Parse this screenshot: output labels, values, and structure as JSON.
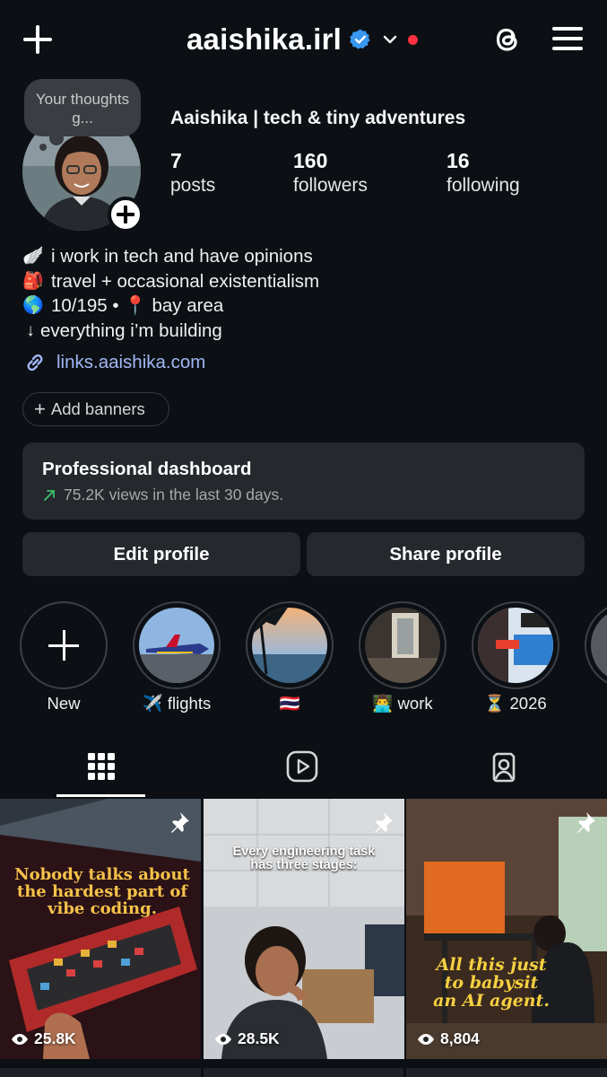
{
  "header": {
    "username": "aaishika.irl",
    "icons": {
      "new_post": "plus-icon",
      "verified": "verified-badge-icon",
      "account_switch": "chevron-down-icon",
      "threads": "threads-icon",
      "menu": "hamburger-menu-icon"
    },
    "accent_colors": {
      "verified": "#3897f0",
      "notification_dot": "#ff3040"
    }
  },
  "profile": {
    "note": "Your thoughts g...",
    "display_name": "Aaishika | tech & tiny adventures",
    "stats": [
      {
        "value": "7",
        "label": "posts"
      },
      {
        "value": "160",
        "label": "followers"
      },
      {
        "value": "16",
        "label": "following"
      }
    ],
    "bio": [
      {
        "emoji": "🪽",
        "text": "i work in tech and have opinions"
      },
      {
        "emoji": "🎒",
        "text": "travel + occasional existentialism"
      },
      {
        "emoji": "🌎",
        "text": "10/195 • 📍 bay area"
      },
      {
        "emoji": "↓",
        "text": "everything i’m building"
      }
    ],
    "link": "links.aaishika.com",
    "link_color": "#a2b6f6"
  },
  "actions": {
    "add_banners": "Add banners",
    "dashboard_title": "Professional dashboard",
    "dashboard_sub": "75.2K views in the last 30 days.",
    "edit_profile": "Edit profile",
    "share_profile": "Share profile"
  },
  "highlights": [
    {
      "label": "New"
    },
    {
      "label": "✈️ flights"
    },
    {
      "label": "🇹🇭"
    },
    {
      "label": "👨‍💻 work"
    },
    {
      "label": "⏳ 2026"
    }
  ],
  "tabs": [
    {
      "name": "posts-grid",
      "icon": "grid-icon",
      "active": true
    },
    {
      "name": "reels",
      "icon": "reels-icon",
      "active": false
    },
    {
      "name": "tagged",
      "icon": "tagged-icon",
      "active": false
    }
  ],
  "posts": [
    {
      "caption": "Nobody talks about the hardest part of vibe coding.",
      "views": "25.8K",
      "pinned": true
    },
    {
      "caption": "Every engineering task has three stages:",
      "views": "28.5K",
      "pinned": true
    },
    {
      "caption": "All this just to babysit an AI agent.",
      "views": "8,804",
      "pinned": true
    }
  ]
}
